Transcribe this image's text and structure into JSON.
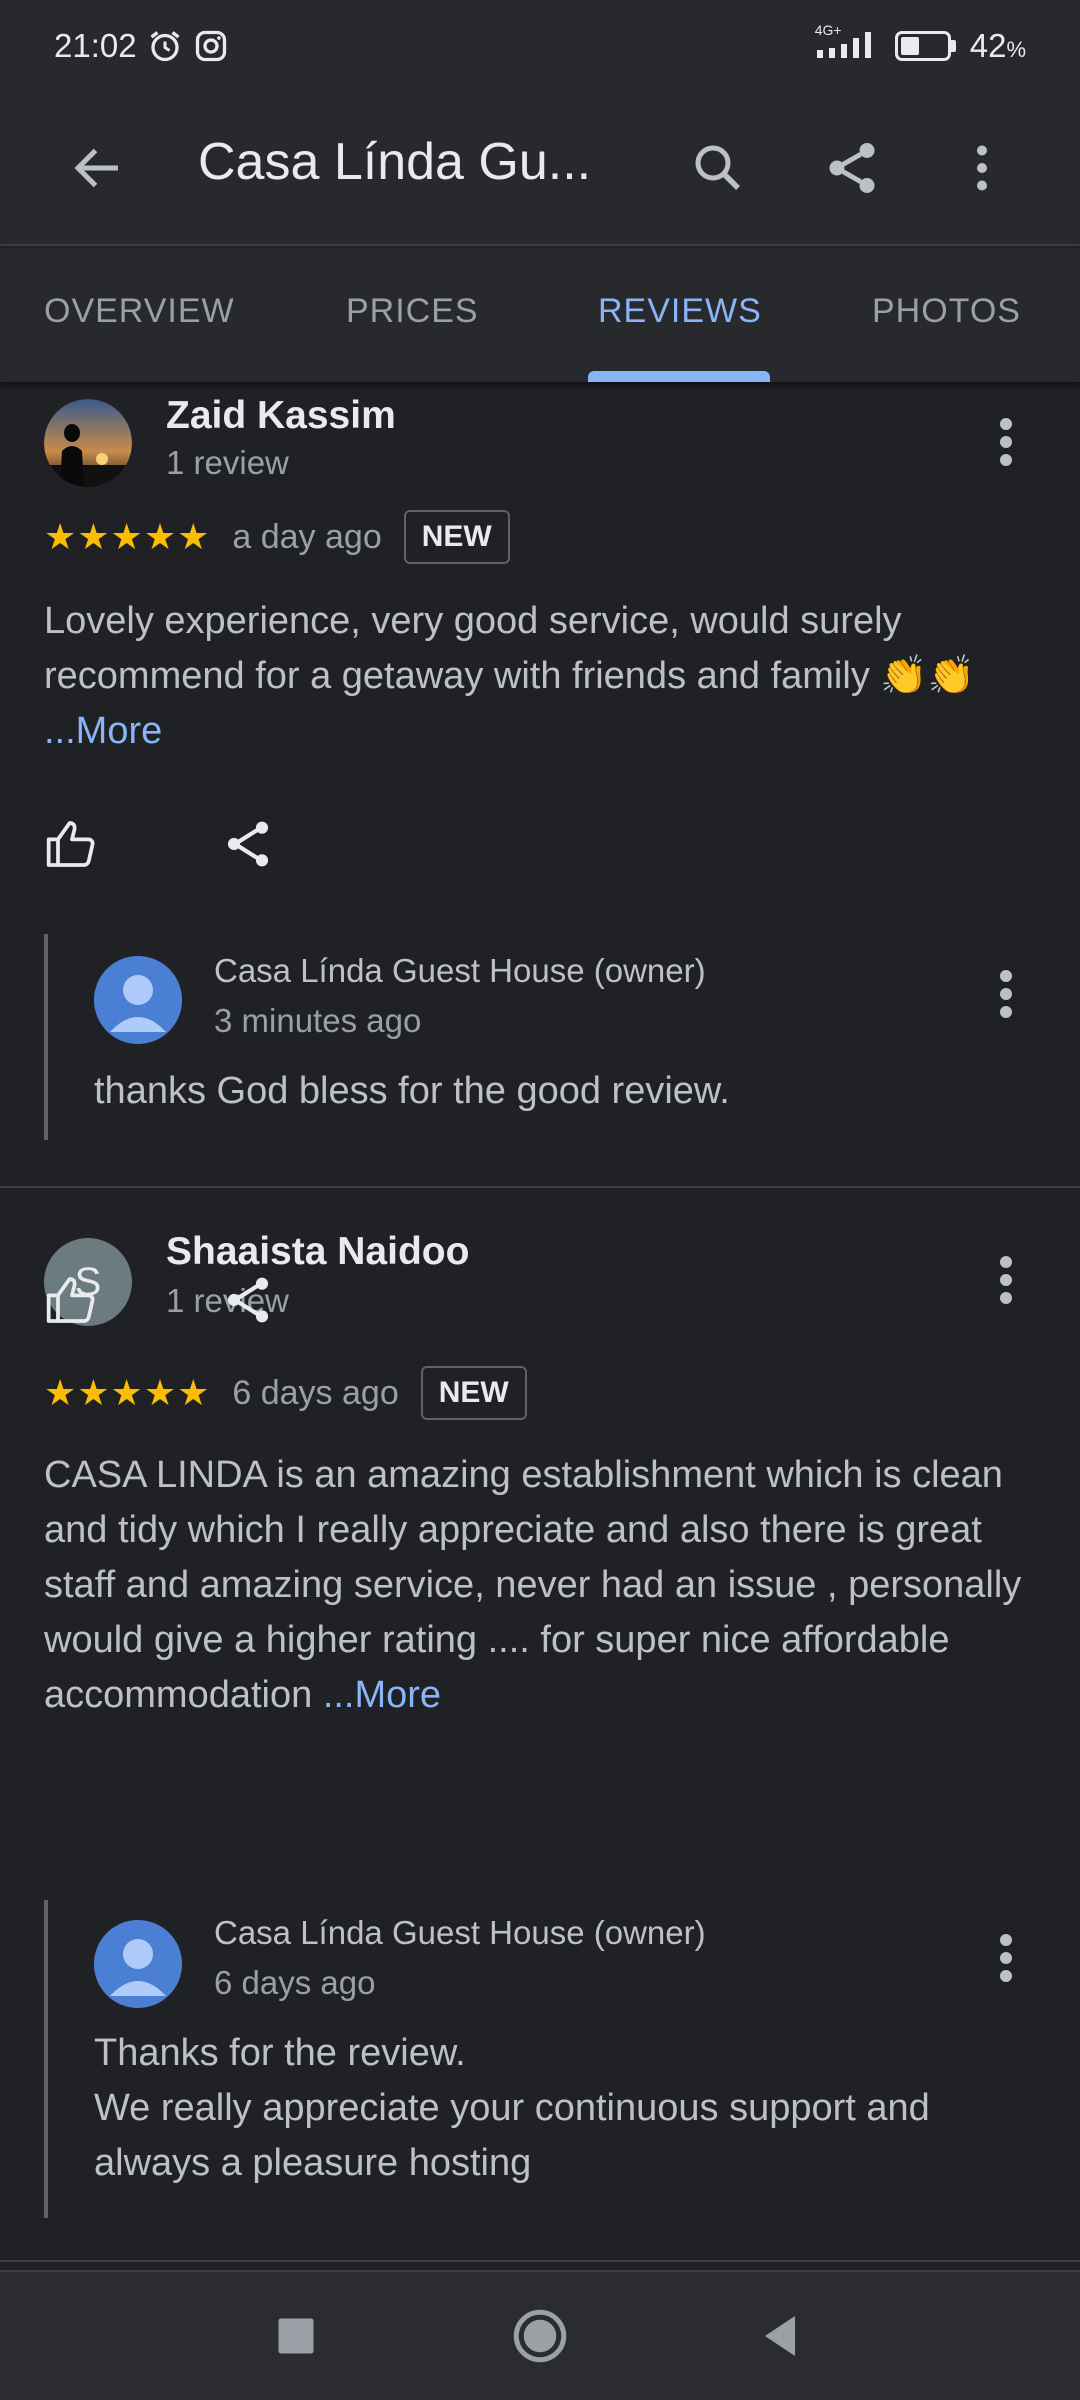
{
  "status_bar": {
    "time": "21:02",
    "network": "4G+",
    "battery": "42",
    "battery_pct_sign": "%"
  },
  "app_bar": {
    "title": "Casa Línda Gu..."
  },
  "tabs": [
    {
      "label": "OVERVIEW",
      "active": false
    },
    {
      "label": "PRICES",
      "active": false
    },
    {
      "label": "REVIEWS",
      "active": true
    },
    {
      "label": "PHOTOS",
      "active": false
    }
  ],
  "reviews": [
    {
      "author": "Zaid Kassim",
      "review_count": "1 review",
      "stars": "★★★★★",
      "rating": 5,
      "time_ago": "a day ago",
      "badge": "NEW",
      "text": "Lovely experience, very good service, would surely recommend for a getaway with friends and family 👏👏 ",
      "more": "...More",
      "owner_reply": {
        "name": "Casa Línda Guest House (owner)",
        "time_ago": "3 minutes ago",
        "text": "thanks God bless for the good review."
      }
    },
    {
      "author": "Shaaista Naidoo",
      "avatar_letter": "S",
      "review_count": "1 review",
      "stars": "★★★★★",
      "rating": 5,
      "time_ago": "6 days ago",
      "badge": "NEW",
      "text": "CASA LINDA is an amazing establishment which is clean and tidy which I really appreciate and also there is great staff and amazing service, never had an issue , personally would give a higher rating .... for super nice affordable accommodation ",
      "more": "...More",
      "owner_reply": {
        "name": "Casa Línda Guest House (owner)",
        "time_ago": "6 days ago",
        "text_lines": [
          "Thanks for the review.",
          "We really appreciate your continuous support and always a pleasure hosting"
        ]
      }
    }
  ],
  "colors": {
    "background": "#202124",
    "accent": "#8ab4f8",
    "star": "#fbbc04",
    "owner_avatar": "#4a7fd4"
  },
  "icons": [
    "back-arrow-icon",
    "search-icon",
    "share-icon",
    "more-vert-icon",
    "thumb-up-icon",
    "alarm-icon",
    "instagram-icon",
    "signal-icon",
    "battery-icon"
  ]
}
